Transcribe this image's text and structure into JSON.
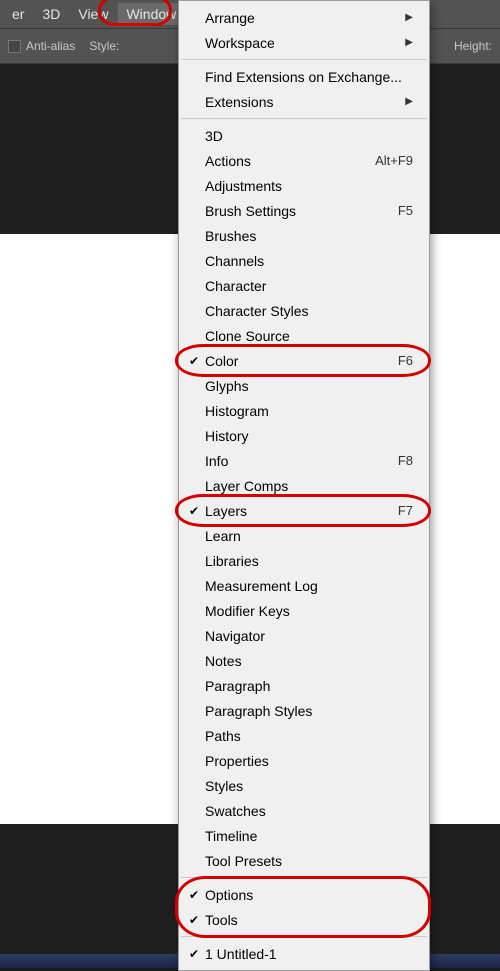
{
  "menubar": {
    "items": [
      {
        "label": "er",
        "open": false
      },
      {
        "label": "3D",
        "open": false
      },
      {
        "label": "View",
        "open": false
      },
      {
        "label": "Window",
        "open": true
      }
    ]
  },
  "optionsBar": {
    "antiAlias": "Anti-alias",
    "styleLabel": "Style:",
    "heightLabel": "Height:"
  },
  "menu": {
    "groups": [
      [
        {
          "label": "Arrange",
          "submenu": true
        },
        {
          "label": "Workspace",
          "submenu": true
        }
      ],
      [
        {
          "label": "Find Extensions on Exchange..."
        },
        {
          "label": "Extensions",
          "submenu": true
        }
      ],
      [
        {
          "label": "3D"
        },
        {
          "label": "Actions",
          "shortcut": "Alt+F9"
        },
        {
          "label": "Adjustments"
        },
        {
          "label": "Brush Settings",
          "shortcut": "F5"
        },
        {
          "label": "Brushes"
        },
        {
          "label": "Channels"
        },
        {
          "label": "Character"
        },
        {
          "label": "Character Styles"
        },
        {
          "label": "Clone Source"
        },
        {
          "label": "Color",
          "shortcut": "F6",
          "checked": true,
          "annot": true
        },
        {
          "label": "Glyphs"
        },
        {
          "label": "Histogram"
        },
        {
          "label": "History"
        },
        {
          "label": "Info",
          "shortcut": "F8"
        },
        {
          "label": "Layer Comps"
        },
        {
          "label": "Layers",
          "shortcut": "F7",
          "checked": true,
          "annot": true
        },
        {
          "label": "Learn"
        },
        {
          "label": "Libraries"
        },
        {
          "label": "Measurement Log"
        },
        {
          "label": "Modifier Keys"
        },
        {
          "label": "Navigator"
        },
        {
          "label": "Notes"
        },
        {
          "label": "Paragraph"
        },
        {
          "label": "Paragraph Styles"
        },
        {
          "label": "Paths"
        },
        {
          "label": "Properties"
        },
        {
          "label": "Styles"
        },
        {
          "label": "Swatches"
        },
        {
          "label": "Timeline"
        },
        {
          "label": "Tool Presets"
        }
      ],
      [
        {
          "label": "Options",
          "checked": true,
          "annot": "optstools"
        },
        {
          "label": "Tools",
          "checked": true,
          "annot": "optstools"
        }
      ],
      [
        {
          "label": "1 Untitled-1",
          "checked": true
        }
      ]
    ]
  }
}
